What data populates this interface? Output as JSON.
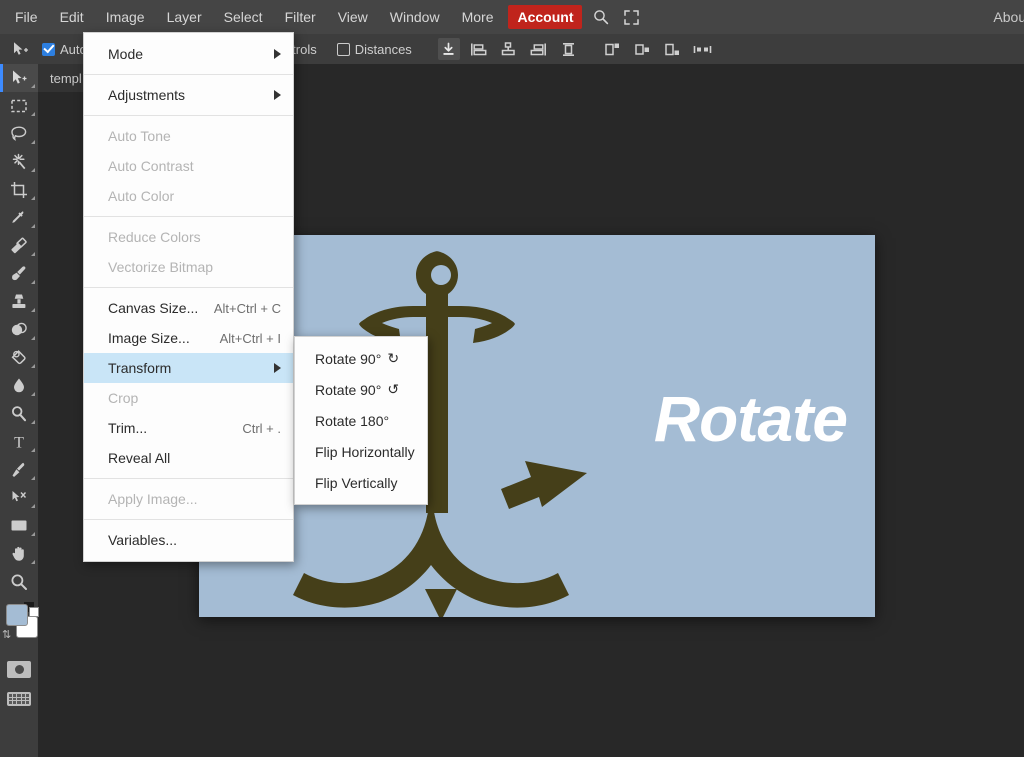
{
  "app": {
    "accent_red": "#c0241c",
    "menubar_bg": "#454545",
    "toolbar_bg": "#3d3d3d",
    "workspace_bg": "#282828",
    "canvas_bg": "#a4bcd4",
    "artwork_color": "#453f19",
    "highlight_blue": "#c9e5f7",
    "checkbox_blue": "#2d7fe0"
  },
  "menubar": {
    "items": [
      {
        "label": "File",
        "name": "menu-file"
      },
      {
        "label": "Edit",
        "name": "menu-edit"
      },
      {
        "label": "Image",
        "name": "menu-image"
      },
      {
        "label": "Layer",
        "name": "menu-layer"
      },
      {
        "label": "Select",
        "name": "menu-select"
      },
      {
        "label": "Filter",
        "name": "menu-filter"
      },
      {
        "label": "View",
        "name": "menu-view"
      },
      {
        "label": "Window",
        "name": "menu-window"
      },
      {
        "label": "More",
        "name": "menu-more"
      }
    ],
    "account_label": "Account",
    "search_icon": "search-icon",
    "fullscreen_icon": "fullscreen-icon",
    "about_label": "About"
  },
  "optionsbar": {
    "tool_icon": "move-tool-icon",
    "auto_label": "Auto",
    "auto_checked": true,
    "transform_controls_label": "m controls",
    "distances_label": "Distances",
    "distances_checked": false,
    "align_buttons": [
      {
        "name": "align-download-button",
        "active": true
      },
      {
        "name": "align-left-edges-button",
        "active": false
      },
      {
        "name": "align-horizontal-centers-button",
        "active": false
      },
      {
        "name": "align-right-edges-button",
        "active": false
      },
      {
        "name": "align-vertical-centers-button",
        "active": false
      },
      {
        "name": "distribute-top-edges-button",
        "active": false
      },
      {
        "name": "distribute-vertical-centers-button",
        "active": false
      },
      {
        "name": "distribute-bottom-edges-button",
        "active": false
      },
      {
        "name": "distribute-horizontal-spacing-button",
        "active": false
      }
    ]
  },
  "document_tab": {
    "title": "templ"
  },
  "toolbar": {
    "tools": [
      {
        "name": "tool-move",
        "icon": "move-tool-icon",
        "selected": true
      },
      {
        "name": "tool-marquee",
        "icon": "rectangular-marquee-icon",
        "selected": false
      },
      {
        "name": "tool-lasso",
        "icon": "lasso-icon",
        "selected": false
      },
      {
        "name": "tool-magic-wand",
        "icon": "magic-wand-icon",
        "selected": false
      },
      {
        "name": "tool-crop",
        "icon": "crop-icon",
        "selected": false
      },
      {
        "name": "tool-eyedropper",
        "icon": "eyedropper-icon",
        "selected": false
      },
      {
        "name": "tool-eraser",
        "icon": "eraser-icon",
        "selected": false
      },
      {
        "name": "tool-brush",
        "icon": "brush-icon",
        "selected": false
      },
      {
        "name": "tool-clone-stamp",
        "icon": "clone-stamp-icon",
        "selected": false
      },
      {
        "name": "tool-blur",
        "icon": "blur-icon",
        "selected": false
      },
      {
        "name": "tool-paint-bucket",
        "icon": "paint-bucket-icon",
        "selected": false
      },
      {
        "name": "tool-gradient-drop",
        "icon": "water-drop-icon",
        "selected": false
      },
      {
        "name": "tool-dodge",
        "icon": "dodge-icon",
        "selected": false
      },
      {
        "name": "tool-type",
        "icon": "type-tool-icon",
        "selected": false
      },
      {
        "name": "tool-pen",
        "icon": "pen-tool-icon",
        "selected": false
      },
      {
        "name": "tool-path-select",
        "icon": "path-select-icon",
        "selected": false
      },
      {
        "name": "tool-shape",
        "icon": "rectangle-shape-icon",
        "selected": false
      },
      {
        "name": "tool-hand",
        "icon": "hand-tool-icon",
        "selected": false
      },
      {
        "name": "tool-zoom",
        "icon": "zoom-tool-icon",
        "selected": false
      }
    ],
    "foreground_color": "#a4bcd4",
    "background_color": "#ffffff",
    "screenshot_button": "screenshot-button",
    "keyboard_button": "keyboard-shortcuts-button"
  },
  "image_menu": {
    "items": [
      {
        "label": "Mode",
        "accel": "",
        "disabled": false,
        "submenu": true,
        "highlight": false,
        "sep_after": true,
        "name": "menu-item-mode"
      },
      {
        "label": "Adjustments",
        "accel": "",
        "disabled": false,
        "submenu": true,
        "highlight": false,
        "sep_after": true,
        "name": "menu-item-adjustments"
      },
      {
        "label": "Auto Tone",
        "accel": "",
        "disabled": true,
        "submenu": false,
        "highlight": false,
        "sep_after": false,
        "name": "menu-item-auto-tone"
      },
      {
        "label": "Auto Contrast",
        "accel": "",
        "disabled": true,
        "submenu": false,
        "highlight": false,
        "sep_after": false,
        "name": "menu-item-auto-contrast"
      },
      {
        "label": "Auto Color",
        "accel": "",
        "disabled": true,
        "submenu": false,
        "highlight": false,
        "sep_after": true,
        "name": "menu-item-auto-color"
      },
      {
        "label": "Reduce Colors",
        "accel": "",
        "disabled": true,
        "submenu": false,
        "highlight": false,
        "sep_after": false,
        "name": "menu-item-reduce-colors"
      },
      {
        "label": "Vectorize Bitmap",
        "accel": "",
        "disabled": true,
        "submenu": false,
        "highlight": false,
        "sep_after": true,
        "name": "menu-item-vectorize-bitmap"
      },
      {
        "label": "Canvas Size...",
        "accel": "Alt+Ctrl + C",
        "disabled": false,
        "submenu": false,
        "highlight": false,
        "sep_after": false,
        "name": "menu-item-canvas-size"
      },
      {
        "label": "Image Size...",
        "accel": "Alt+Ctrl + I",
        "disabled": false,
        "submenu": false,
        "highlight": false,
        "sep_after": false,
        "name": "menu-item-image-size"
      },
      {
        "label": "Transform",
        "accel": "",
        "disabled": false,
        "submenu": true,
        "highlight": true,
        "sep_after": false,
        "name": "menu-item-transform"
      },
      {
        "label": "Crop",
        "accel": "",
        "disabled": true,
        "submenu": false,
        "highlight": false,
        "sep_after": false,
        "name": "menu-item-crop"
      },
      {
        "label": "Trim...",
        "accel": "Ctrl + .",
        "disabled": false,
        "submenu": false,
        "highlight": false,
        "sep_after": false,
        "name": "menu-item-trim"
      },
      {
        "label": "Reveal All",
        "accel": "",
        "disabled": false,
        "submenu": false,
        "highlight": false,
        "sep_after": true,
        "name": "menu-item-reveal-all"
      },
      {
        "label": "Apply Image...",
        "accel": "",
        "disabled": true,
        "submenu": false,
        "highlight": false,
        "sep_after": true,
        "name": "menu-item-apply-image"
      },
      {
        "label": "Variables...",
        "accel": "",
        "disabled": false,
        "submenu": false,
        "highlight": false,
        "sep_after": false,
        "name": "menu-item-variables"
      }
    ]
  },
  "transform_submenu": {
    "items": [
      {
        "label": "Rotate 90°",
        "glyph": "↻",
        "name": "submenu-item-rotate-90-cw"
      },
      {
        "label": "Rotate 90°",
        "glyph": "↺",
        "name": "submenu-item-rotate-90-ccw"
      },
      {
        "label": "Rotate 180°",
        "glyph": "",
        "name": "submenu-item-rotate-180"
      },
      {
        "label": "Flip Horizontally",
        "glyph": "",
        "name": "submenu-item-flip-horizontally"
      },
      {
        "label": "Flip Vertically",
        "glyph": "",
        "name": "submenu-item-flip-vertically"
      }
    ]
  },
  "canvas": {
    "text": "Rotate",
    "text_color": "#ffffff",
    "background_color": "#a4bcd4",
    "artwork": "anchor-graphic"
  }
}
